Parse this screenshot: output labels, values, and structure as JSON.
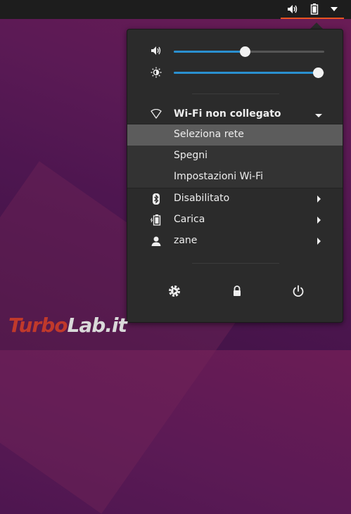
{
  "topbar": {
    "tray_icons": [
      "speaker-icon",
      "battery-icon",
      "dropdown-triangle-icon"
    ],
    "accent_color": "#e95420"
  },
  "menu": {
    "volume": {
      "icon": "speaker-icon",
      "level": 0.47
    },
    "brightness": {
      "icon": "brightness-icon",
      "level": 0.96
    },
    "wifi": {
      "icon": "wifi-icon",
      "label": "Wi-Fi non collegato",
      "expanded": true,
      "submenu": [
        {
          "label": "Seleziona rete",
          "highlighted": true
        },
        {
          "label": "Spegni",
          "highlighted": false
        },
        {
          "label": "Impostazioni Wi-Fi",
          "highlighted": false
        }
      ]
    },
    "items": [
      {
        "icon": "bluetooth-icon",
        "label": "Disabilitato"
      },
      {
        "icon": "battery-charging-icon",
        "label": "Carica"
      },
      {
        "icon": "user-icon",
        "label": "zane"
      }
    ],
    "bottom_buttons": [
      "settings-icon",
      "lock-icon",
      "power-icon"
    ]
  },
  "watermark": {
    "part1": "Turbo",
    "part2": "Lab.it"
  },
  "colors": {
    "slider": "#2a90d0",
    "highlight": "#5c5c5c",
    "panel": "#2b2b2b"
  }
}
